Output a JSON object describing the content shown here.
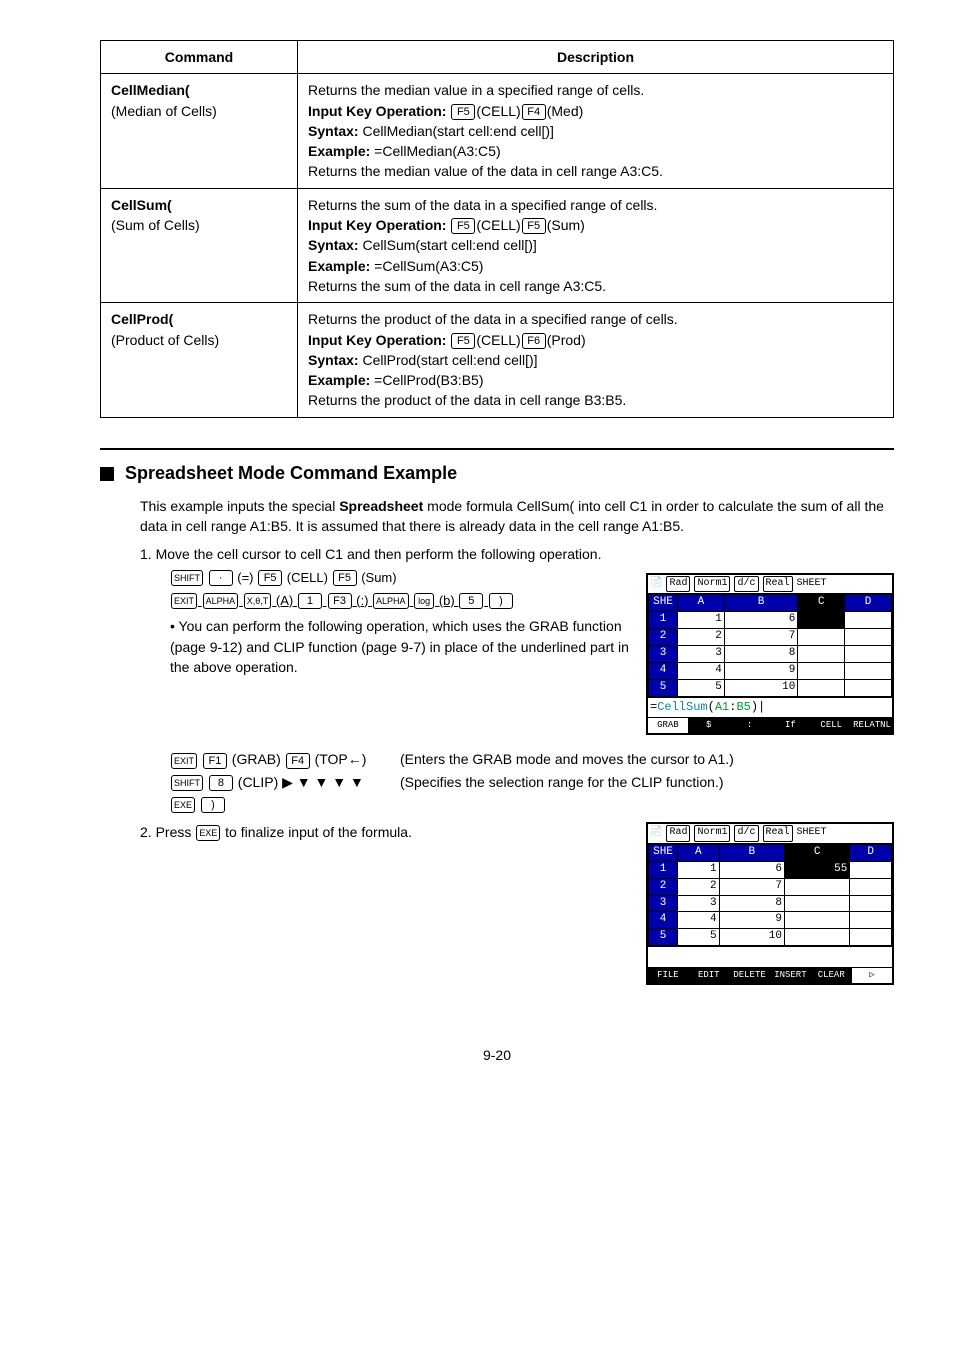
{
  "table": {
    "headers": [
      "Command",
      "Description"
    ],
    "rows": [
      {
        "cmd_name": "CellMedian(",
        "cmd_sub": "(Median of Cells)",
        "desc_intro": "Returns the median value in a specified range of cells.",
        "input_label": "Input Key Operation:",
        "input_k1": "F5",
        "input_t1": "(CELL)",
        "input_k2": "F4",
        "input_t2": "(Med)",
        "syntax_label": "Syntax:",
        "syntax_val": " CellMedian(start cell:end cell[)]",
        "example_label": "Example:",
        "example_val": " =CellMedian(A3:C5)",
        "desc_out": "Returns the median value of the data in cell range A3:C5."
      },
      {
        "cmd_name": "CellSum(",
        "cmd_sub": "(Sum of Cells)",
        "desc_intro": "Returns the sum of the data in a specified range of cells.",
        "input_label": "Input Key Operation:",
        "input_k1": "F5",
        "input_t1": "(CELL)",
        "input_k2": "F5",
        "input_t2": "(Sum)",
        "syntax_label": "Syntax:",
        "syntax_val": " CellSum(start cell:end cell[)]",
        "example_label": "Example:",
        "example_val": " =CellSum(A3:C5)",
        "desc_out": "Returns the sum of the data in cell range A3:C5."
      },
      {
        "cmd_name": "CellProd(",
        "cmd_sub": "(Product of Cells)",
        "desc_intro": "Returns the product of the data in a specified range of cells.",
        "input_label": "Input Key Operation:",
        "input_k1": "F5",
        "input_t1": "(CELL)",
        "input_k2": "F6",
        "input_t2": "(Prod)",
        "syntax_label": "Syntax:",
        "syntax_val": " CellProd(start cell:end cell[)]",
        "example_label": "Example:",
        "example_val": " =CellProd(B3:B5)",
        "desc_out": "Returns the product of the data in cell range B3:B5."
      }
    ]
  },
  "section_title": "Spreadsheet Mode Command Example",
  "intro": "This example inputs the special Spreadsheet mode formula CellSum( into cell C1 in order to calculate the sum of all the data in cell range A1:B5. It is assumed that there is already data in the cell range A1:B5.",
  "intro_bold": "Spreadsheet",
  "step1": "1. Move the cell cursor to cell C1 and then perform the following operation.",
  "keyline1": {
    "k1": "SHIFT",
    "k2": "·",
    "t1": "(=)",
    "k3": "F5",
    "t2": "(CELL)",
    "k4": "F5",
    "t3": "(Sum)"
  },
  "keyline2": {
    "k1": "EXIT",
    "k2": "ALPHA",
    "k3": "X,θ,T",
    "t1": "(A)",
    "k4": "1",
    "k5": "F3",
    "t2": "(:)",
    "k6": "ALPHA",
    "k7": "log",
    "t3": "(b)",
    "k8": "5",
    "k9": ")"
  },
  "bullet_text": "You can perform the following operation, which uses the GRAB function (page 9-12) and CLIP function (page 9-7) in place of the underlined part in the above operation.",
  "sub1_left": {
    "k1": "EXIT",
    "k2": "F1",
    "t1": "(GRAB)",
    "k3": "F4",
    "t2": "(TOP←)"
  },
  "sub1_right": "(Enters the GRAB mode and moves the cursor to A1.)",
  "sub2_left": {
    "k1": "SHIFT",
    "k2": "8",
    "t1": "(CLIP)",
    "arrows": "▶ ▼ ▼ ▼ ▼"
  },
  "sub2_right": "(Specifies the selection range for the CLIP function.)",
  "sub3_left": {
    "k1": "EXE",
    "k2": ")"
  },
  "step2": "2. Press EXE to finalize input of the formula.",
  "step2_pre": "2. Press ",
  "step2_key": "EXE",
  "step2_post": " to finalize input of the formula.",
  "calc1": {
    "status": [
      "Rad",
      "Norm1",
      "d/c",
      "Real",
      "SHEET"
    ],
    "cols": [
      "SHE",
      "A",
      "B",
      "C",
      "D"
    ],
    "rows": [
      [
        "1",
        "1",
        "6",
        "",
        ""
      ],
      [
        "2",
        "2",
        "7",
        "",
        ""
      ],
      [
        "3",
        "3",
        "8",
        "",
        ""
      ],
      [
        "4",
        "4",
        "9",
        "",
        ""
      ],
      [
        "5",
        "5",
        "10",
        "",
        ""
      ]
    ],
    "formula": "=CellSum(A1:B5)|",
    "fkeys": [
      "GRAB",
      "$",
      ":",
      "If",
      "CELL",
      "RELATNL"
    ]
  },
  "calc2": {
    "status": [
      "Rad",
      "Norm1",
      "d/c",
      "Real",
      "SHEET"
    ],
    "cols": [
      "SHE",
      "A",
      "B",
      "C",
      "D"
    ],
    "rows": [
      [
        "1",
        "1",
        "6",
        "55",
        ""
      ],
      [
        "2",
        "2",
        "7",
        "",
        ""
      ],
      [
        "3",
        "3",
        "8",
        "",
        ""
      ],
      [
        "4",
        "4",
        "9",
        "",
        ""
      ],
      [
        "5",
        "5",
        "10",
        "",
        ""
      ]
    ],
    "formula": "",
    "fkeys": [
      "FILE",
      "EDIT",
      "DELETE",
      "INSERT",
      "CLEAR",
      "▷"
    ]
  },
  "page_num": "9-20"
}
